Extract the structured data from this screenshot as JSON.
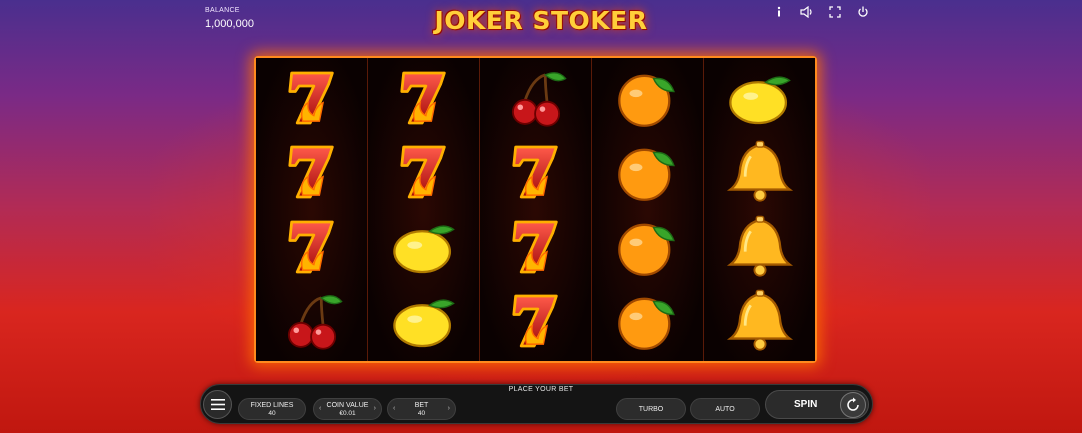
{
  "balance": {
    "label": "BALANCE",
    "value": "1,000,000"
  },
  "title": "JOKER STOKER",
  "icons": [
    "info-icon",
    "sound-icon",
    "fullscreen-icon",
    "power-icon"
  ],
  "reels": [
    [
      "seven",
      "seven",
      "seven",
      "cherry"
    ],
    [
      "seven",
      "seven",
      "lemon",
      "lemon"
    ],
    [
      "cherry",
      "seven",
      "seven",
      "seven"
    ],
    [
      "orange",
      "orange",
      "orange",
      "orange"
    ],
    [
      "lemon",
      "bell",
      "bell",
      "bell"
    ]
  ],
  "controls": {
    "place_bet": "PLACE YOUR BET",
    "fixed_lines_label": "FIXED LINES",
    "fixed_lines_value": "40",
    "coin_value_label": "COIN VALUE",
    "coin_value_value": "€0.01",
    "bet_label": "BET",
    "bet_value": "40",
    "turbo": "TURBO",
    "auto": "AUTO",
    "spin": "SPIN"
  },
  "colors": {
    "accent": "#ff8a1e",
    "title": "#ffcf3a",
    "bar": "#141414"
  }
}
